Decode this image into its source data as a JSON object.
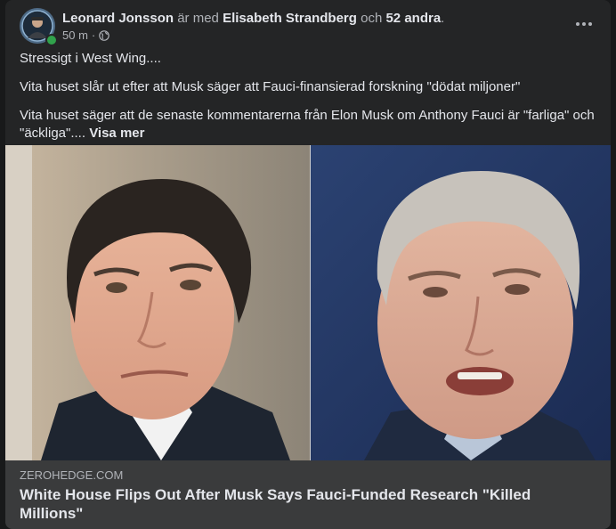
{
  "post": {
    "author": "Leonard Jonsson",
    "with_text": " är med ",
    "tagged": "Elisabeth Strandberg",
    "and_text": " och ",
    "others": "52 andra",
    "period": ".",
    "time": "50 m",
    "separator": "·",
    "privacy_icon": "globe-icon",
    "more_icon": "more-options-icon",
    "paragraphs": [
      "Stressigt i West Wing....",
      "Vita huset slår ut efter att Musk säger att Fauci-finansierad forskning \"dödat miljoner\"",
      "Vita huset säger att de senaste kommentarerna från Elon Musk om Anthony Fauci är \"farliga\" och \"äckliga\"...."
    ],
    "see_more": "Visa mer"
  },
  "link": {
    "domain": "ZEROHEDGE.COM",
    "title": "White House Flips Out After Musk Says Fauci-Funded Research \"Killed Millions\""
  },
  "colors": {
    "card_bg": "#242526",
    "link_bg": "#3a3b3c",
    "online": "#31a24c",
    "text_primary": "#e4e6eb",
    "text_secondary": "#b0b3b8"
  }
}
